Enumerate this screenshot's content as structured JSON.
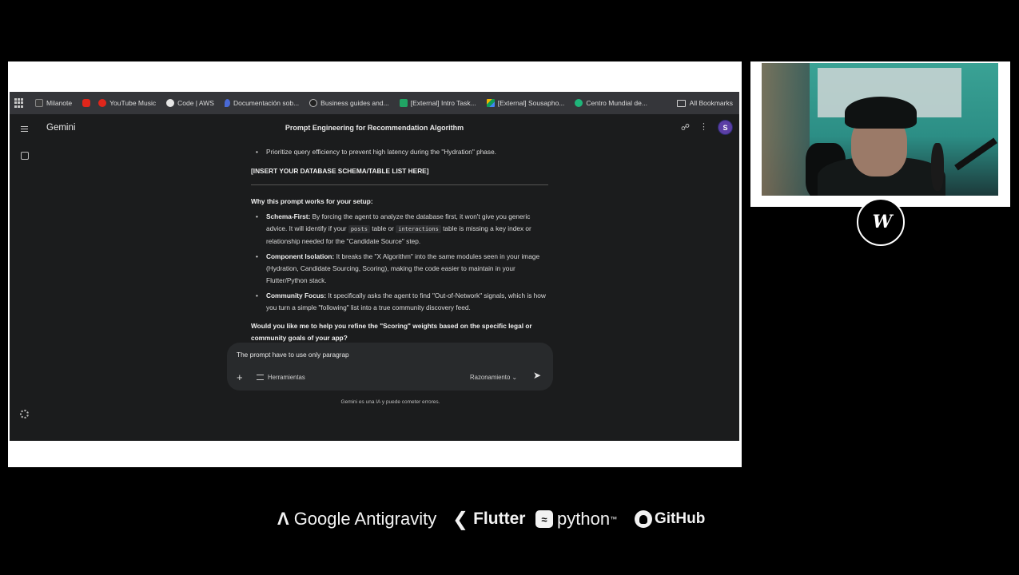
{
  "bookmarks": {
    "items": [
      {
        "label": "Milanote",
        "icon": "milanote-icon",
        "color": "#3d3d3d"
      },
      {
        "label": "",
        "icon": "youtube-icon",
        "color": "#e0261b"
      },
      {
        "label": "YouTube Music",
        "icon": "youtube-music-icon",
        "color": "#e0261b"
      },
      {
        "label": "Code | AWS",
        "icon": "github-icon",
        "color": "#e6e6e6"
      },
      {
        "label": "Documentación sob...",
        "icon": "drop-icon",
        "color": "#4a6ad6"
      },
      {
        "label": "Business guides and...",
        "icon": "globe-icon",
        "color": "#222222"
      },
      {
        "label": "[External] Intro Task...",
        "icon": "sheets-icon",
        "color": "#21a464"
      },
      {
        "label": "[External] Sousapho...",
        "icon": "drive-icon",
        "color": "#f4b400"
      },
      {
        "label": "Centro Mundial de...",
        "icon": "leaf-icon",
        "color": "#1fb57a"
      }
    ],
    "all_label": "All Bookmarks"
  },
  "app": {
    "brand": "Gemini",
    "conversation_title": "Prompt Engineering for Recommendation Algorithm",
    "avatar_initial": "S"
  },
  "chat": {
    "top_bullet": "Prioritize query efficiency to prevent high latency during the \"Hydration\" phase.",
    "insert_placeholder": "[INSERT YOUR DATABASE SCHEMA/TABLE LIST HERE]",
    "why_heading": "Why this prompt works for your setup:",
    "benefits": [
      {
        "title": "Schema-First:",
        "text_1": "By forcing the agent to analyze the database first, it won't give you generic advice. It will identify if your",
        "code_1": "posts",
        "text_2": "table or",
        "code_2": "interactions",
        "text_3": "table is missing a key index or relationship needed for the \"Candidate Source\" step."
      },
      {
        "title": "Component Isolation:",
        "text": "It breaks the \"X Algorithm\" into the same modules seen in your image (Hydration, Candidate Sourcing, Scoring), making the code easier to maintain in your Flutter/Python stack."
      },
      {
        "title": "Community Focus:",
        "text": "It specifically asks the agent to find \"Out-of-Network\" signals, which is how you turn a simple \"following\" list into a true community discovery feed."
      }
    ],
    "followup": "Would you like me to help you refine the \"Scoring\" weights based on the specific legal or community goals of your app?"
  },
  "input": {
    "value": "The prompt have to use only paragrap",
    "tools_label": "Herramientas",
    "mode_label": "Razonamiento ⌄"
  },
  "disclaimer": "Gemini es una IA y puede cometer errores.",
  "tech_logos": {
    "antigravity": "Google Antigravity",
    "flutter": "Flutter",
    "python": "python",
    "python_tm": "™",
    "github": "GitHub"
  }
}
